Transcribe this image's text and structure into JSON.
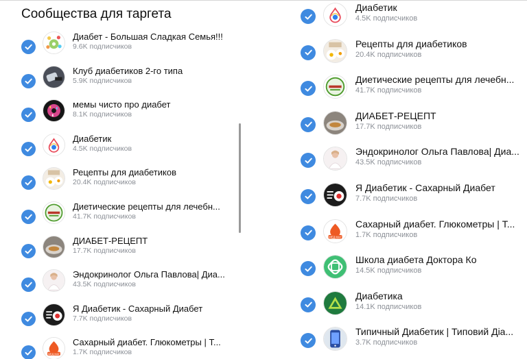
{
  "title": "Сообщества для таргета",
  "colors": {
    "accent": "#3f8ae0",
    "muted": "#8b8f96"
  },
  "left_list": [
    {
      "name": "Диабет - Большая Сладкая Семья!!!",
      "subs": "9.6K подписчиков",
      "avatar_icon": "sweets-family-avatar"
    },
    {
      "name": "Клуб диабетиков 2-го типа",
      "subs": "5.9K подписчиков",
      "avatar_icon": "glucometer-avatar"
    },
    {
      "name": "мемы чисто про диабет",
      "subs": "8.1K подписчиков",
      "avatar_icon": "donut-avatar"
    },
    {
      "name": "Диабетик",
      "subs": "4.5K подписчиков",
      "avatar_icon": "drop-logo-avatar"
    },
    {
      "name": "Рецепты для диабетиков",
      "subs": "20.4K подписчиков",
      "avatar_icon": "food-avatar"
    },
    {
      "name": "Диетические рецепты для лечебн...",
      "subs": "41.7K подписчиков",
      "avatar_icon": "diet-badge-avatar"
    },
    {
      "name": "ДИАБЕТ-РЕЦЕПТ",
      "subs": "17.7K подписчиков",
      "avatar_icon": "dish-avatar"
    },
    {
      "name": "Эндокринолог Ольга Павлова| Диа...",
      "subs": "43.5K подписчиков",
      "avatar_icon": "doctor-avatar"
    },
    {
      "name": "Я Диабетик - Сахарный Диабет",
      "subs": "7.7K подписчиков",
      "avatar_icon": "dark-logo-avatar"
    },
    {
      "name": "Сахарный диабет. Глюкометры | Т...",
      "subs": "1.7K подписчиков",
      "avatar_icon": "med-mag-avatar"
    }
  ],
  "right_list": [
    {
      "name": "Диабетик",
      "subs": "4.5K подписчиков",
      "avatar_icon": "drop-logo-avatar"
    },
    {
      "name": "Рецепты для диабетиков",
      "subs": "20.4K подписчиков",
      "avatar_icon": "food-avatar"
    },
    {
      "name": "Диетические рецепты для лечебн...",
      "subs": "41.7K подписчиков",
      "avatar_icon": "diet-badge-avatar"
    },
    {
      "name": "ДИАБЕТ-РЕЦЕПТ",
      "subs": "17.7K подписчиков",
      "avatar_icon": "dish-avatar"
    },
    {
      "name": "Эндокринолог Ольга Павлова| Диа...",
      "subs": "43.5K подписчиков",
      "avatar_icon": "doctor-avatar"
    },
    {
      "name": "Я Диабетик - Сахарный Диабет",
      "subs": "7.7K подписчиков",
      "avatar_icon": "dark-logo-avatar"
    },
    {
      "name": "Сахарный диабет. Глюкометры | Т...",
      "subs": "1.7K подписчиков",
      "avatar_icon": "med-mag-avatar"
    },
    {
      "name": "Школа диабета Доктора Ко",
      "subs": "14.5K подписчиков",
      "avatar_icon": "green-knot-avatar"
    },
    {
      "name": "Диабетика",
      "subs": "14.1K подписчиков",
      "avatar_icon": "green-triangle-avatar"
    },
    {
      "name": "Типичный Диабетик | Типовий Діа...",
      "subs": "3.7K подписчиков",
      "avatar_icon": "phone-avatar"
    }
  ]
}
